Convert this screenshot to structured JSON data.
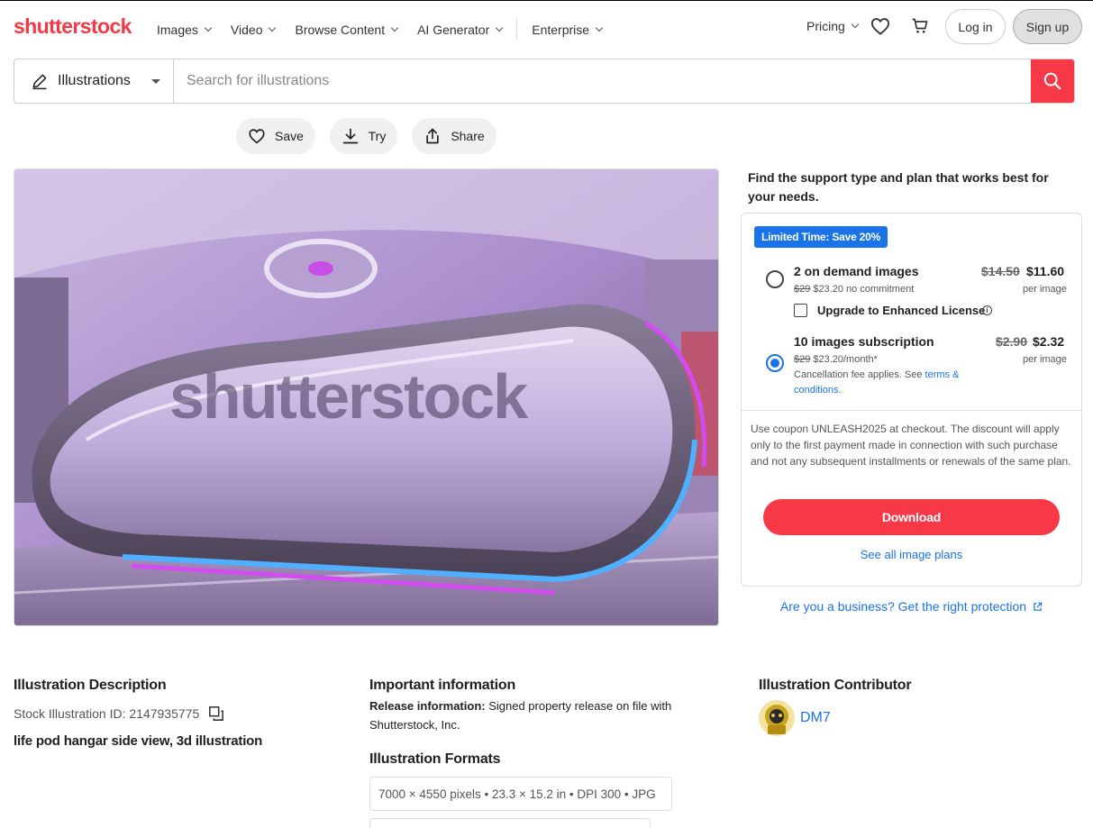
{
  "header": {
    "logo": "shutterstock",
    "nav": [
      "Images",
      "Video",
      "Browse Content",
      "AI Generator",
      "Enterprise"
    ],
    "pricing": "Pricing",
    "login": "Log in",
    "signup": "Sign up"
  },
  "search": {
    "type": "Illustrations",
    "placeholder": "Search for illustrations"
  },
  "actions": {
    "save": "Save",
    "try": "Try",
    "share": "Share"
  },
  "hero": {
    "watermark": "shutterstock"
  },
  "plans": {
    "intro": "Find the support type and plan that works best for your needs.",
    "badge": "Limited Time: Save 20%",
    "option1": {
      "title": "2 on demand images",
      "sub_old": "$29",
      "sub_rest": "$23.20 no commitment",
      "old_price": "$14.50",
      "new_price": "$11.60",
      "per": "per image",
      "selected": false
    },
    "upgrade": "Upgrade to Enhanced License",
    "option2": {
      "title": "10 images subscription",
      "sub_old": "$29",
      "sub_rest": "$23.20/month*",
      "note_prefix": "Cancellation fee applies. See ",
      "note_link": "terms & conditions",
      "note_suffix": ".",
      "old_price": "$2.90",
      "new_price": "$2.32",
      "per": "per image",
      "selected": true
    },
    "coupon": "Use coupon UNLEASH2025 at checkout. The discount will apply only to the first payment made in connection with such purchase and not any subsequent installments or renewals of the same plan.",
    "download": "Download",
    "see_all": "See all image plans",
    "business": "Are you a business? Get the right protection"
  },
  "info": {
    "description_title": "Illustration Description",
    "stock_id": "Stock Illustration ID: 2147935775",
    "description": "life pod hangar side view, 3d illustration",
    "important_title": "Important information",
    "release_label": "Release information:",
    "release_text": " Signed property release on file with Shutterstock, Inc.",
    "formats_title": "Illustration Formats",
    "format1": "7000 × 4550 pixels • 23.3 × 15.2 in • DPI 300 • JPG",
    "contributor_title": "Illustration Contributor",
    "contributor": "DM7"
  },
  "colors": {
    "brand": "#f63847",
    "link": "#1a73e8"
  }
}
